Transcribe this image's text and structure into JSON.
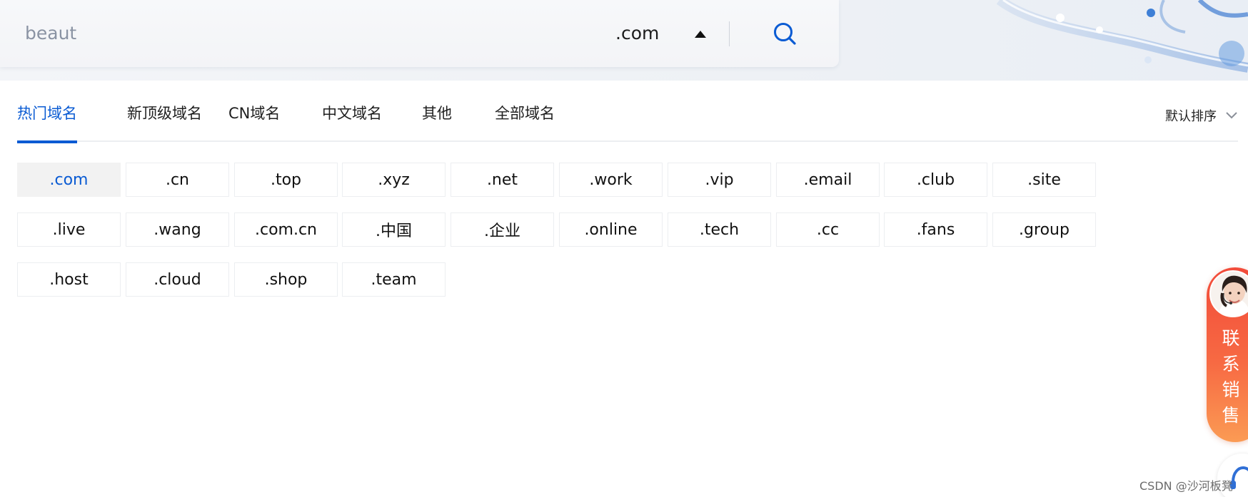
{
  "search": {
    "value": "beaut",
    "suffix_selected": ".com"
  },
  "tabs": [
    {
      "label": "热门域名",
      "active": true
    },
    {
      "label": "新顶级域名",
      "active": false
    },
    {
      "label": "CN域名",
      "active": false
    },
    {
      "label": "中文域名",
      "active": false
    },
    {
      "label": "其他",
      "active": false
    },
    {
      "label": "全部域名",
      "active": false
    }
  ],
  "sort": {
    "label": "默认排序"
  },
  "suffixes": [
    ".com",
    ".cn",
    ".top",
    ".xyz",
    ".net",
    ".work",
    ".vip",
    ".email",
    ".club",
    ".site",
    ".live",
    ".wang",
    ".com.cn",
    ".中国",
    ".企业",
    ".online",
    ".tech",
    ".cc",
    ".fans",
    ".group",
    ".host",
    ".cloud",
    ".shop",
    ".team"
  ],
  "selected_suffix": ".com",
  "contact": {
    "label": "联系销售"
  },
  "watermark": "CSDN @沙河板凳",
  "colors": {
    "accent": "#0a5bd3",
    "contact_gradient_top": "#f24b3a",
    "contact_gradient_bottom": "#fb9b54"
  }
}
